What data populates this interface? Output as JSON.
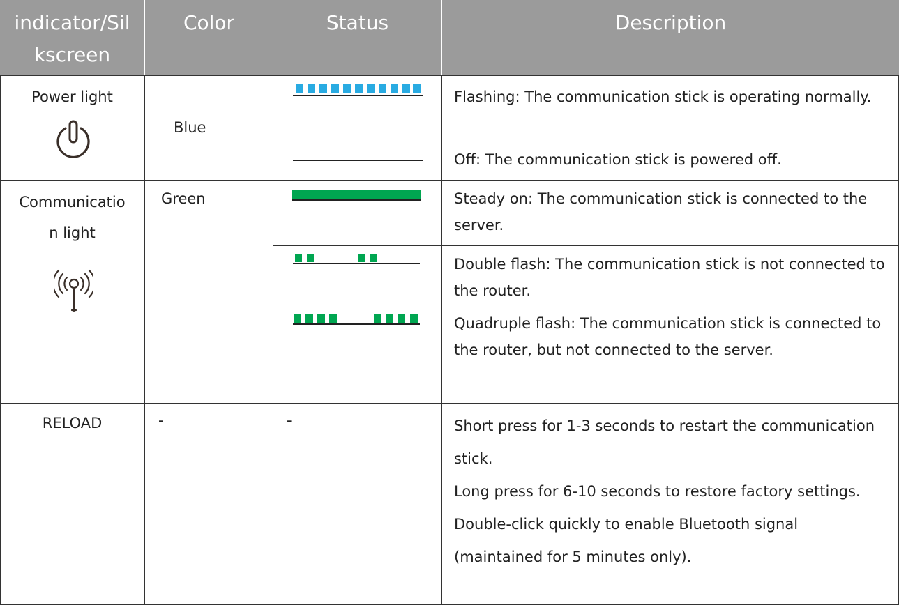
{
  "header": {
    "col1": "indicator/Silkscreen",
    "col1_line1": "indicator/Sil",
    "col1_line2": "kscreen",
    "col2": "Color",
    "col3": "Status",
    "col4": "Description"
  },
  "rows": {
    "power": {
      "name": "Power light",
      "icon": "power-icon",
      "color": "Blue",
      "status": [
        {
          "pattern": "blue-flashing",
          "description": "Flashing: The communication stick is operating normally."
        },
        {
          "pattern": "off",
          "description": "Off: The communication stick is powered off."
        }
      ]
    },
    "communication": {
      "name": "Communication light",
      "name_line1": "Communicatio",
      "name_line2": "n light",
      "icon": "antenna-signal-icon",
      "color": "Green",
      "status": [
        {
          "pattern": "green-steady",
          "description": "Steady on: The communication stick is connected to the server."
        },
        {
          "pattern": "green-double-flash",
          "description": "Double flash: The communication stick is not connected to the router."
        },
        {
          "pattern": "green-quadruple-flash",
          "description": "Quadruple flash: The communication stick is connected to the router, but not connected to the server."
        }
      ]
    },
    "reload": {
      "name": "RELOAD",
      "color": "-",
      "status": "-",
      "descriptions": [
        "Short press for 1-3 seconds to restart the communication stick.",
        "Long press for 6-10 seconds to restore factory settings.",
        "Double-click quickly to enable Bluetooth signal (maintained for 5 minutes only)."
      ]
    }
  },
  "colors": {
    "header_bg": "#9b9b9b",
    "blue": "#29abe2",
    "green": "#00a651",
    "line": "#333333"
  }
}
